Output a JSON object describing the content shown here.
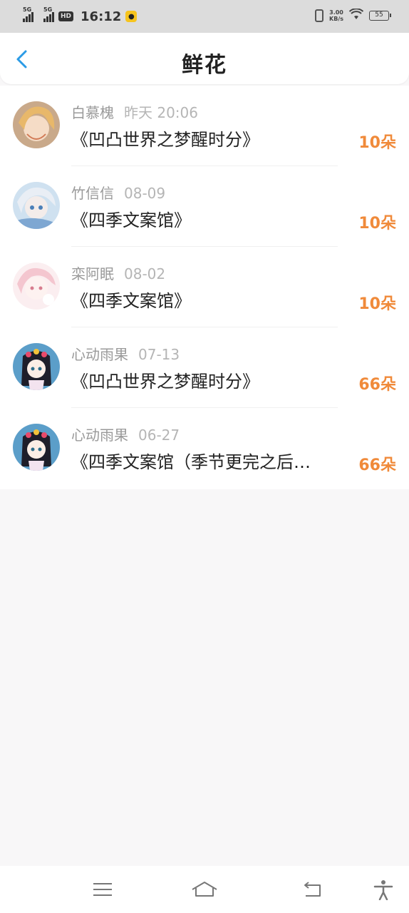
{
  "status_bar": {
    "signal1_label": "5G",
    "signal2_label": "5G",
    "hd_label": "HD",
    "time": "16:12",
    "net_speed_value": "3.00",
    "net_speed_unit": "KB/s",
    "battery": "55"
  },
  "header": {
    "title": "鲜花"
  },
  "items": [
    {
      "name": "白慕槐",
      "date": "昨天 20:06",
      "book": "《凹凸世界之梦醒时分》",
      "amount": "10朵"
    },
    {
      "name": "竹信信",
      "date": "08-09",
      "book": "《四季文案馆》",
      "amount": "10朵"
    },
    {
      "name": "栾阿眠",
      "date": "08-02",
      "book": "《四季文案馆》",
      "amount": "10朵"
    },
    {
      "name": "心动雨果",
      "date": "07-13",
      "book": "《凹凸世界之梦醒时分》",
      "amount": "66朵"
    },
    {
      "name": "心动雨果",
      "date": "06-27",
      "book": "《四季文案馆（季节更完之后…",
      "amount": "66朵"
    }
  ],
  "colors": {
    "accent": "#2b9be6",
    "amount": "#f08a3a",
    "background": "#f8f7f8"
  },
  "icons": [
    "back-arrow-icon",
    "menu-icon",
    "home-icon",
    "back-icon",
    "accessibility-icon"
  ]
}
